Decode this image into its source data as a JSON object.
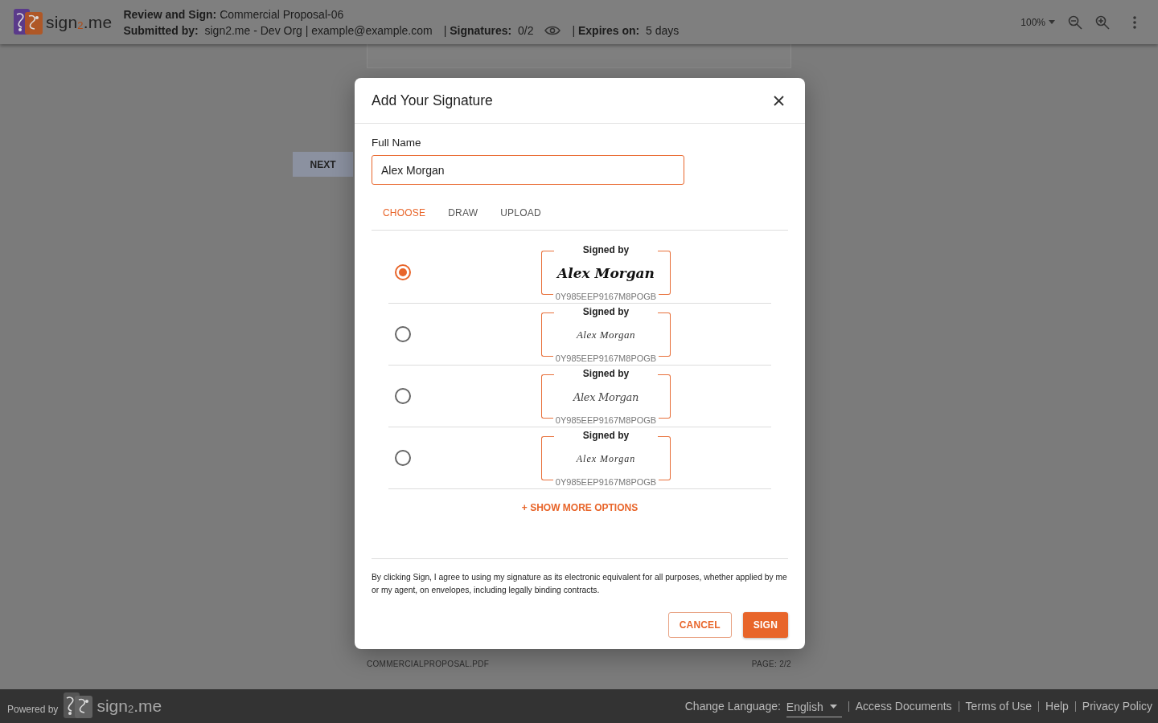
{
  "header": {
    "logo": "sign$_{2}$.me",
    "title": "**Review and Sign:** Commercial Proposal-06",
    "details": [
      "**Submitted by:**  sign2.me - Dev Org | example@example.com",
      "| **Signatures:**  0/2",
      "| **Expires on:**  5 days"
    ],
    "zoom": "100%"
  },
  "document": {
    "next_button": "NEXT",
    "file_name": "COMMERCIALPROPOSAL.PDF",
    "page": "PAGE: 2/2"
  },
  "dialog": {
    "title": "Add Your Signature",
    "name_field": {
      "label": "Full Name",
      "value": "Alex Morgan",
      "focused": true
    },
    "tabs": [
      {
        "label": "CHOOSE",
        "selected": true
      },
      {
        "label": "DRAW",
        "selected": false
      },
      {
        "label": "UPLOAD",
        "selected": false
      }
    ],
    "options": [
      {
        "heading": "Signed by",
        "signature": "Alex Morgan",
        "code": "0Y985EEP9167M8POGB",
        "kind": "bold",
        "selected": true
      },
      {
        "heading": "Signed by",
        "signature": "Alex Morgan",
        "code": "0Y985EEP9167M8POGB",
        "kind": "thin",
        "selected": false
      },
      {
        "heading": "Signed by",
        "signature": "Alex Morgan",
        "code": "0Y985EEP9167M8POGB",
        "kind": "flourish",
        "selected": false
      },
      {
        "heading": "Signed by",
        "signature": "Alex Morgan",
        "code": "0Y985EEP9167M8POGB",
        "kind": "slanted",
        "selected": false
      }
    ],
    "more_link": "+ SHOW MORE OPTIONS",
    "disclaimer": "By clicking Sign, I agree to using my signature as its electronic equivalent for all purposes, whether applied by me or my agent, on envelopes, including legally binding contracts.",
    "buttons": [
      {
        "label": "CANCEL",
        "kind": "outlined"
      },
      {
        "label": "SIGN",
        "kind": "filled"
      }
    ]
  },
  "footer": {
    "powered_by": "Powered by",
    "logo": "sign$_{2}$.me",
    "language_label": "Change Language:",
    "language": "English",
    "links": [
      "Access Documents",
      "Terms of Use",
      "Help",
      "Privacy Policy"
    ]
  }
}
